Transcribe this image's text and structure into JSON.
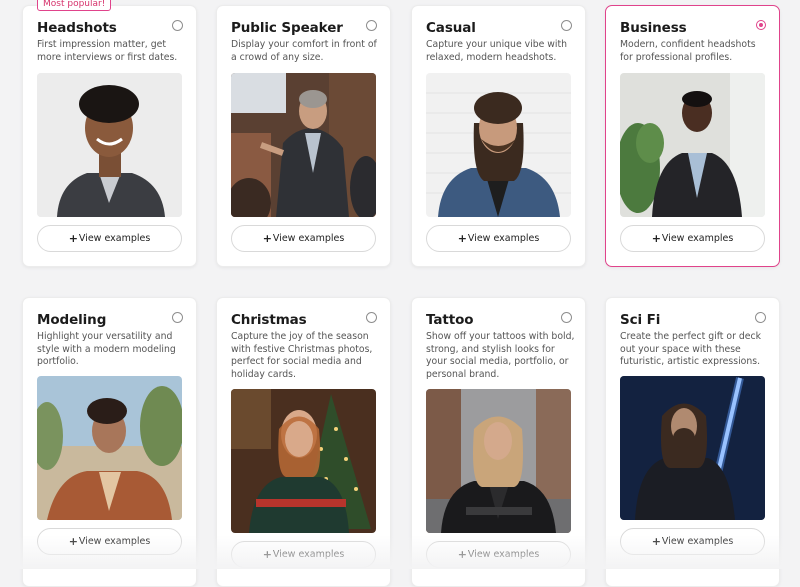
{
  "badge": {
    "most_popular": "Most popular!"
  },
  "view_label": "View examples",
  "cards": [
    {
      "title": "Headshots",
      "description": "First impression matter, get more interviews or first dates.",
      "selected": false
    },
    {
      "title": "Public Speaker",
      "description": "Display your comfort in front of a crowd of any size.",
      "selected": false
    },
    {
      "title": "Casual",
      "description": "Capture your unique vibe with relaxed, modern headshots.",
      "selected": false
    },
    {
      "title": "Business",
      "description": "Modern, confident headshots for professional profiles.",
      "selected": true
    },
    {
      "title": "Modeling",
      "description": "Highlight your versatility and style with a modern modeling portfolio.",
      "selected": false
    },
    {
      "title": "Christmas",
      "description": "Capture the joy of the season with festive Christmas photos, perfect for social media and holiday cards.",
      "selected": false
    },
    {
      "title": "Tattoo",
      "description": "Show off your tattoos with bold, strong, and stylish looks for your social media, portfolio, or personal brand.",
      "selected": false
    },
    {
      "title": "Sci Fi",
      "description": "Create the perfect gift or deck out your space with these futuristic, artistic expressions.",
      "selected": false
    }
  ],
  "colors": {
    "accent": "#e0438b",
    "background": "#f3f3f4"
  }
}
